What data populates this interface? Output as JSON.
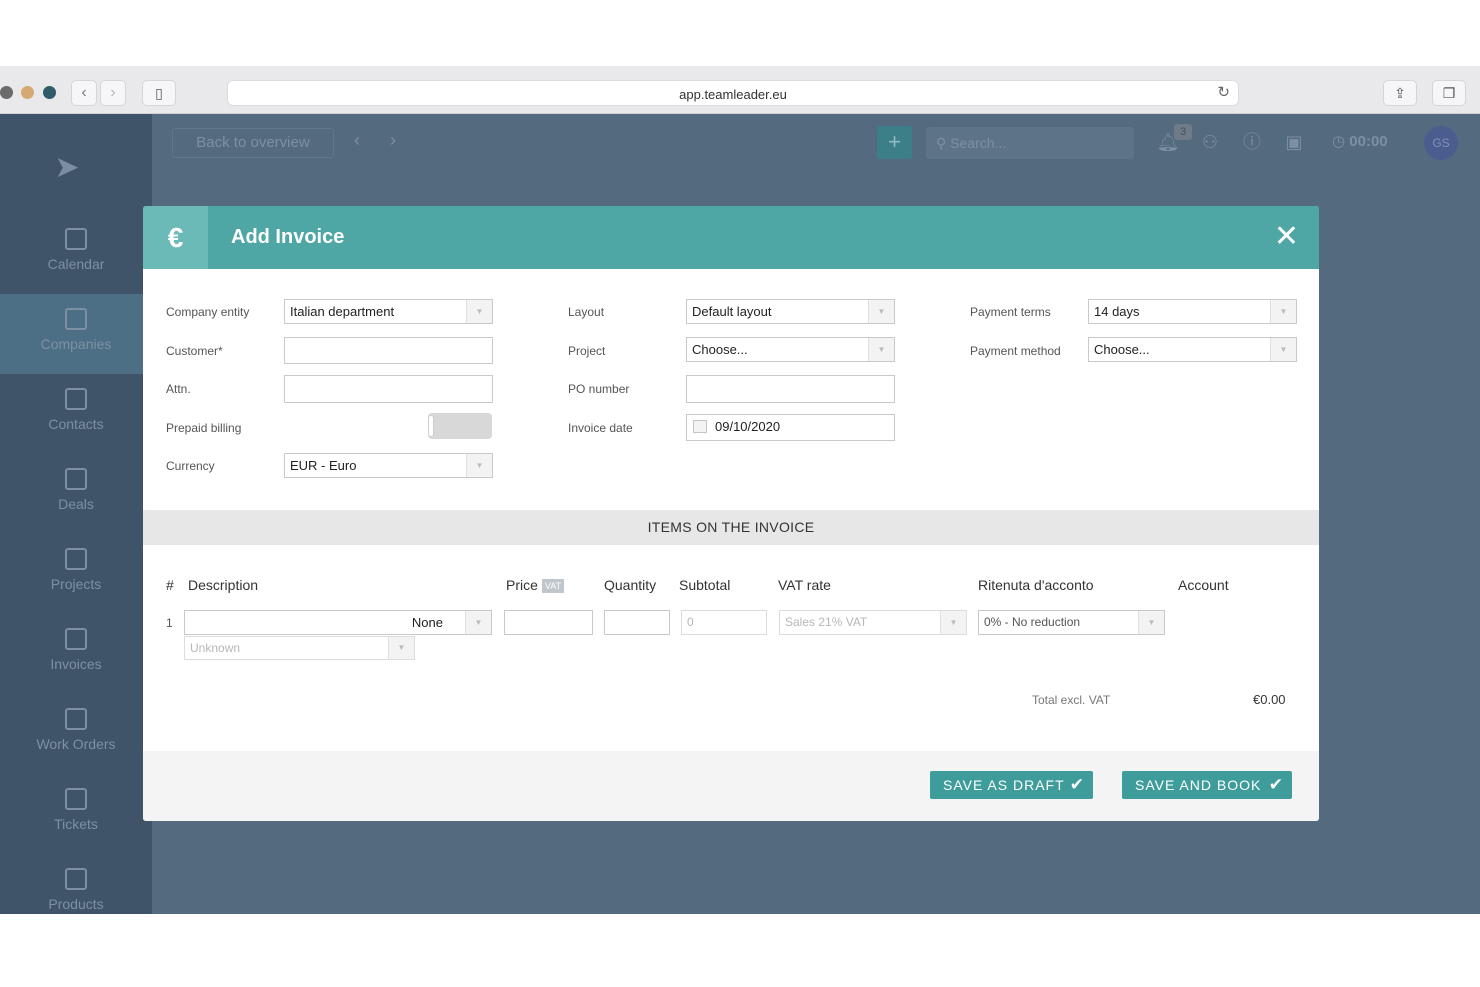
{
  "browser": {
    "url": "app.teamleader.eu",
    "traffic_light_colors": [
      "#6b6b6b",
      "#d6a974",
      "#2f5c68"
    ]
  },
  "app": {
    "back_label": "Back to overview",
    "search_placeholder": "Search...",
    "notifications_badge": "3",
    "timer": "00:00",
    "avatar_initials": "GS",
    "sidebar": [
      {
        "label": "Calendar",
        "icon": "calendar-icon",
        "active": false
      },
      {
        "label": "Companies",
        "icon": "building-icon",
        "active": true
      },
      {
        "label": "Contacts",
        "icon": "contact-card-icon",
        "active": false
      },
      {
        "label": "Deals",
        "icon": "checkmark-icon",
        "active": false
      },
      {
        "label": "Projects",
        "icon": "stack-icon",
        "active": false
      },
      {
        "label": "Invoices",
        "icon": "invoice-icon",
        "active": false
      },
      {
        "label": "Work Orders",
        "icon": "helmet-icon",
        "active": false
      },
      {
        "label": "Tickets",
        "icon": "tag-icon",
        "active": false
      },
      {
        "label": "Products",
        "icon": "edit-icon",
        "active": false
      }
    ]
  },
  "modal": {
    "title": "Add Invoice",
    "header_icon": "€",
    "header_color": "#4fa7a5",
    "fields": {
      "company_entity": {
        "label": "Company entity",
        "value": "Italian department"
      },
      "customer": {
        "label": "Customer*",
        "value": ""
      },
      "attn": {
        "label": "Attn.",
        "value": ""
      },
      "prepaid_billing": {
        "label": "Prepaid billing",
        "enabled": false
      },
      "currency": {
        "label": "Currency",
        "value": "EUR - Euro"
      },
      "layout": {
        "label": "Layout",
        "value": "Default layout"
      },
      "project": {
        "label": "Project",
        "value": "Choose..."
      },
      "po_number": {
        "label": "PO number",
        "value": ""
      },
      "invoice_date": {
        "label": "Invoice date",
        "value": "09/10/2020"
      },
      "payment_terms": {
        "label": "Payment terms",
        "value": "14 days"
      },
      "payment_method": {
        "label": "Payment method",
        "value": "Choose..."
      }
    },
    "items_title": "ITEMS ON THE INVOICE",
    "columns": {
      "num": "#",
      "description": "Description",
      "price": "Price",
      "vat_tag": "VAT",
      "quantity": "Quantity",
      "subtotal": "Subtotal",
      "vat_rate": "VAT rate",
      "ritenuta": "Ritenuta d'acconto",
      "account": "Account"
    },
    "rows": [
      {
        "num": "1",
        "description_select": "None",
        "price": "",
        "quantity": "",
        "subtotal": "0",
        "vat_rate": "Sales 21% VAT",
        "ritenuta": "0% - No reduction",
        "sub_select": "Unknown"
      }
    ],
    "total_label": "Total excl. VAT",
    "total_value": "€0.00",
    "buttons": {
      "draft": "SAVE AS DRAFT",
      "book": "SAVE AND BOOK"
    },
    "button_color": "#3e9d9b"
  }
}
